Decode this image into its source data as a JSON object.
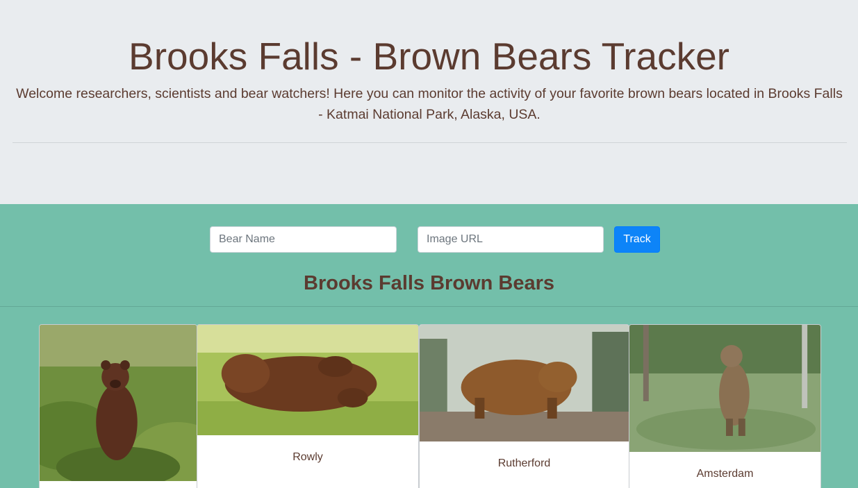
{
  "header": {
    "title": "Brooks Falls - Brown Bears Tracker",
    "lead": "Welcome researchers, scientists and bear watchers! Here you can monitor the activity of your favorite brown bears located in Brooks Falls - Katmai National Park, Alaska, USA."
  },
  "form": {
    "bear_name_placeholder": "Bear Name",
    "image_url_placeholder": "Image URL",
    "track_label": "Track"
  },
  "section": {
    "title": "Brooks Falls Brown Bears"
  },
  "bears": [
    {
      "name": ""
    },
    {
      "name": "Rowly"
    },
    {
      "name": "Rutherford"
    },
    {
      "name": "Amsterdam"
    }
  ],
  "colors": {
    "jumbotron_bg": "#e9ecef",
    "main_bg": "#73bfaa",
    "text_brown": "#5b3b30",
    "button_blue": "#0d84f8"
  }
}
